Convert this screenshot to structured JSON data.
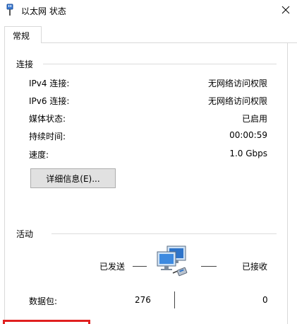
{
  "window": {
    "title": "以太网 状态",
    "close_icon": "close-icon",
    "app_icon": "ethernet-plug-icon"
  },
  "tabs": [
    {
      "label": "常规"
    }
  ],
  "connection": {
    "title": "连接",
    "rows": [
      {
        "label": "IPv4 连接:",
        "value": "无网络访问权限"
      },
      {
        "label": "IPv6 连接:",
        "value": "无网络访问权限"
      },
      {
        "label": "媒体状态:",
        "value": "已启用"
      },
      {
        "label": "持续时间:",
        "value": "00:00:59"
      },
      {
        "label": "速度:",
        "value": "1.0 Gbps"
      }
    ],
    "details_button": "详细信息(E)..."
  },
  "activity": {
    "title": "活动",
    "sent_label": "已发送",
    "received_label": "已接收",
    "packets_label": "数据包:",
    "packets_sent": "276",
    "packets_received": "0",
    "network_icon": "network-computers-icon"
  },
  "colors": {
    "accent_red": "#e02020"
  }
}
